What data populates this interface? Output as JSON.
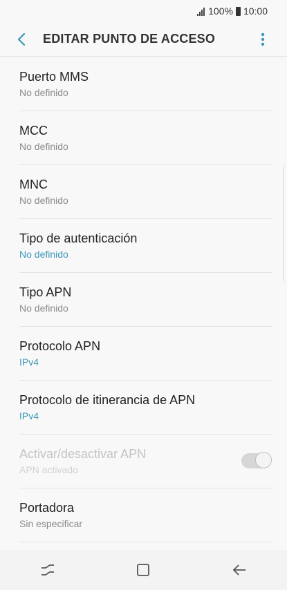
{
  "status_bar": {
    "battery": "100%",
    "time": "10:00"
  },
  "header": {
    "title": "EDITAR PUNTO DE ACCESO",
    "back_icon": "chevron-left-icon",
    "menu_icon": "more-vert-icon"
  },
  "colors": {
    "accent": "#3a96b8",
    "divider": "#e4e4e4",
    "background": "#f8f8f8"
  },
  "settings": [
    {
      "label": "Puerto MMS",
      "value": "No definido"
    },
    {
      "label": "MCC",
      "value": "No definido"
    },
    {
      "label": "MNC",
      "value": "No definido"
    },
    {
      "label": "Tipo de autenticación",
      "value": "No definido"
    },
    {
      "label": "Tipo APN",
      "value": "No definido"
    },
    {
      "label": "Protocolo APN",
      "value": "IPv4"
    },
    {
      "label": "Protocolo de itinerancia de APN",
      "value": "IPv4"
    },
    {
      "label": "Activar/desactivar APN",
      "value": "APN activado",
      "toggle": true,
      "disabled": true
    },
    {
      "label": "Portadora",
      "value": "Sin especificar"
    }
  ],
  "nav_bar": {
    "recents_icon": "recents-icon",
    "home_icon": "home-icon",
    "back_icon": "back-arrow-icon"
  }
}
